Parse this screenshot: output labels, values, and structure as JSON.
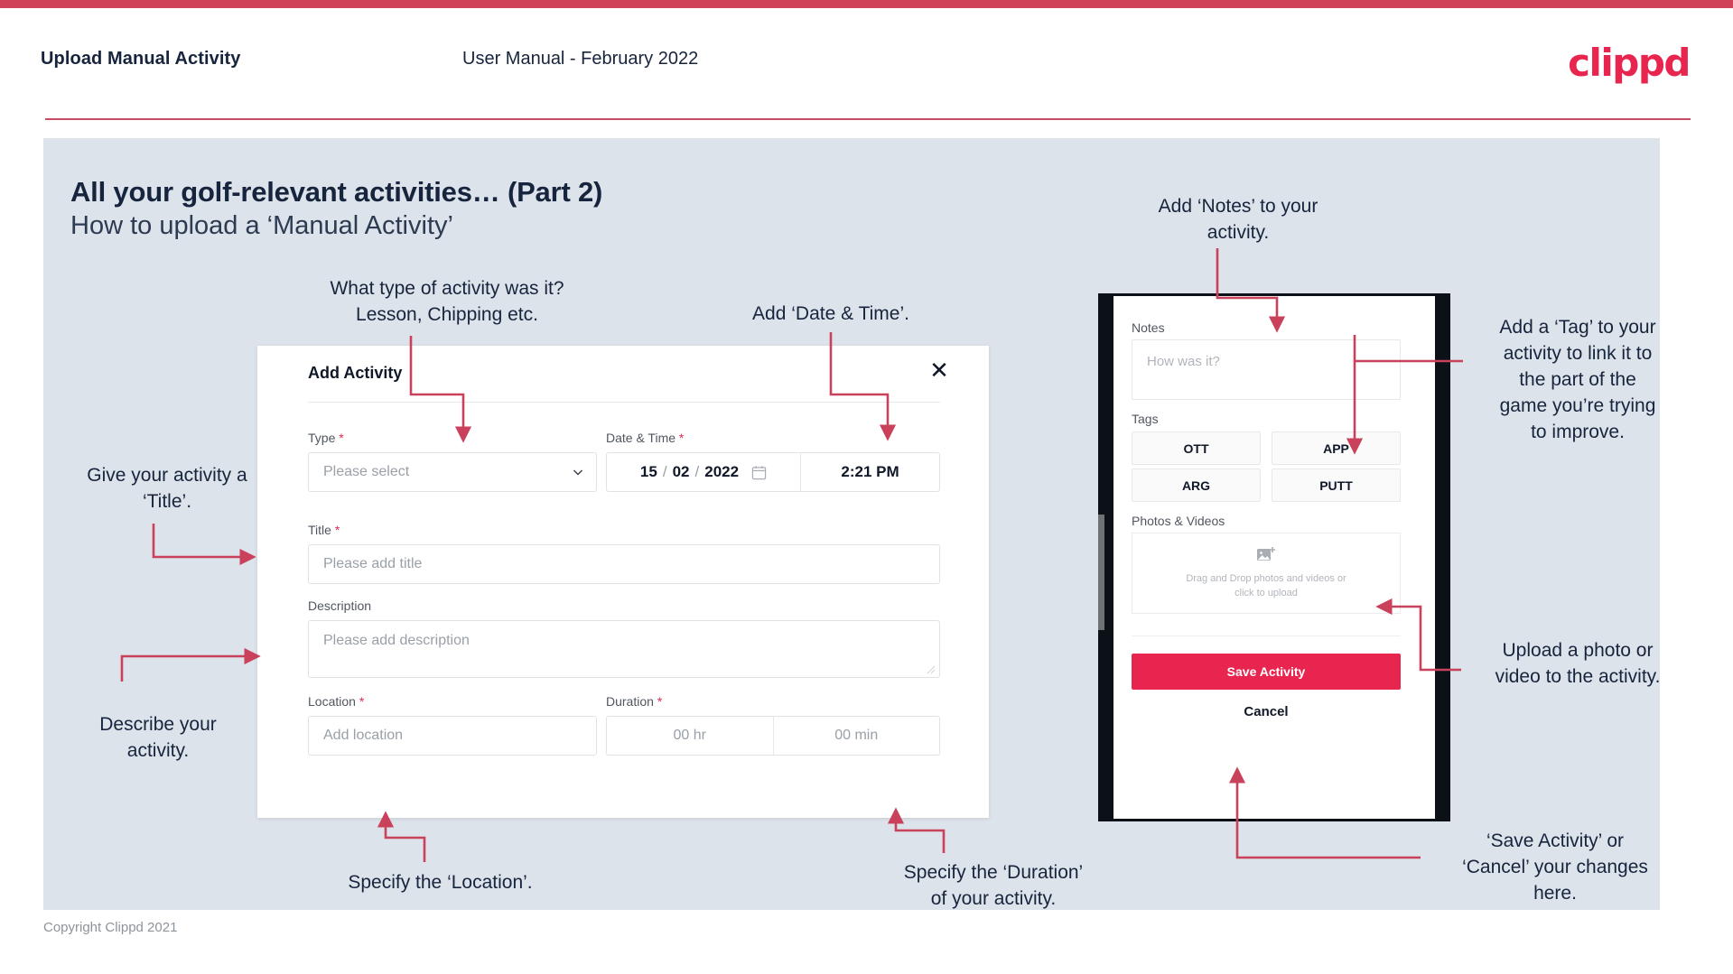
{
  "header": {
    "title": "Upload Manual Activity",
    "subtitle": "User Manual - February 2022",
    "logo": "clippd"
  },
  "slide": {
    "title": "All your golf-relevant activities… (Part 2)",
    "subtitle": "How to upload a ‘Manual Activity’"
  },
  "modal": {
    "title": "Add Activity",
    "close_icon": "close-icon",
    "fields": {
      "type": {
        "label": "Type",
        "required": "*",
        "placeholder": "Please select"
      },
      "datetime": {
        "label": "Date & Time",
        "required": "*",
        "day": "15",
        "sep1": "/",
        "month": "02",
        "sep2": "/",
        "year": "2022",
        "time": "2:21 PM"
      },
      "title": {
        "label": "Title",
        "required": "*",
        "placeholder": "Please add title"
      },
      "description": {
        "label": "Description",
        "placeholder": "Please add description"
      },
      "location": {
        "label": "Location",
        "required": "*",
        "placeholder": "Add location"
      },
      "duration": {
        "label": "Duration",
        "required": "*",
        "hours": "00 hr",
        "minutes": "00 min"
      }
    }
  },
  "phone": {
    "notes": {
      "label": "Notes",
      "placeholder": "How was it?"
    },
    "tags": {
      "label": "Tags",
      "items": [
        "OTT",
        "APP",
        "ARG",
        "PUTT"
      ]
    },
    "photos": {
      "label": "Photos & Videos",
      "dropzone_line1": "Drag and Drop photos and videos or",
      "dropzone_line2": "click to upload",
      "icon": "add-image-icon"
    },
    "save_label": "Save Activity",
    "cancel_label": "Cancel"
  },
  "annotations": {
    "type": "What type of activity was it?\nLesson, Chipping etc.",
    "datetime": "Add ‘Date & Time’.",
    "title": "Give your activity a\n‘Title’.",
    "description": "Describe your\nactivity.",
    "location": "Specify the ‘Location’.",
    "duration": "Specify the ‘Duration’\nof your activity.",
    "notes": "Add ‘Notes’ to your\nactivity.",
    "tags": "Add a ‘Tag’ to your\nactivity to link it to\nthe part of the\ngame you’re trying\nto improve.",
    "upload": "Upload a photo or\nvideo to the activity.",
    "save": "‘Save Activity’ or\n‘Cancel’ your changes\nhere."
  },
  "footer": {
    "copyright": "Copyright Clippd 2021"
  },
  "colors": {
    "brand": "#e8254f",
    "strip": "#cf4257",
    "slide_bg": "#dde3ea",
    "ink": "#17243d",
    "arrow": "#c9415a"
  }
}
